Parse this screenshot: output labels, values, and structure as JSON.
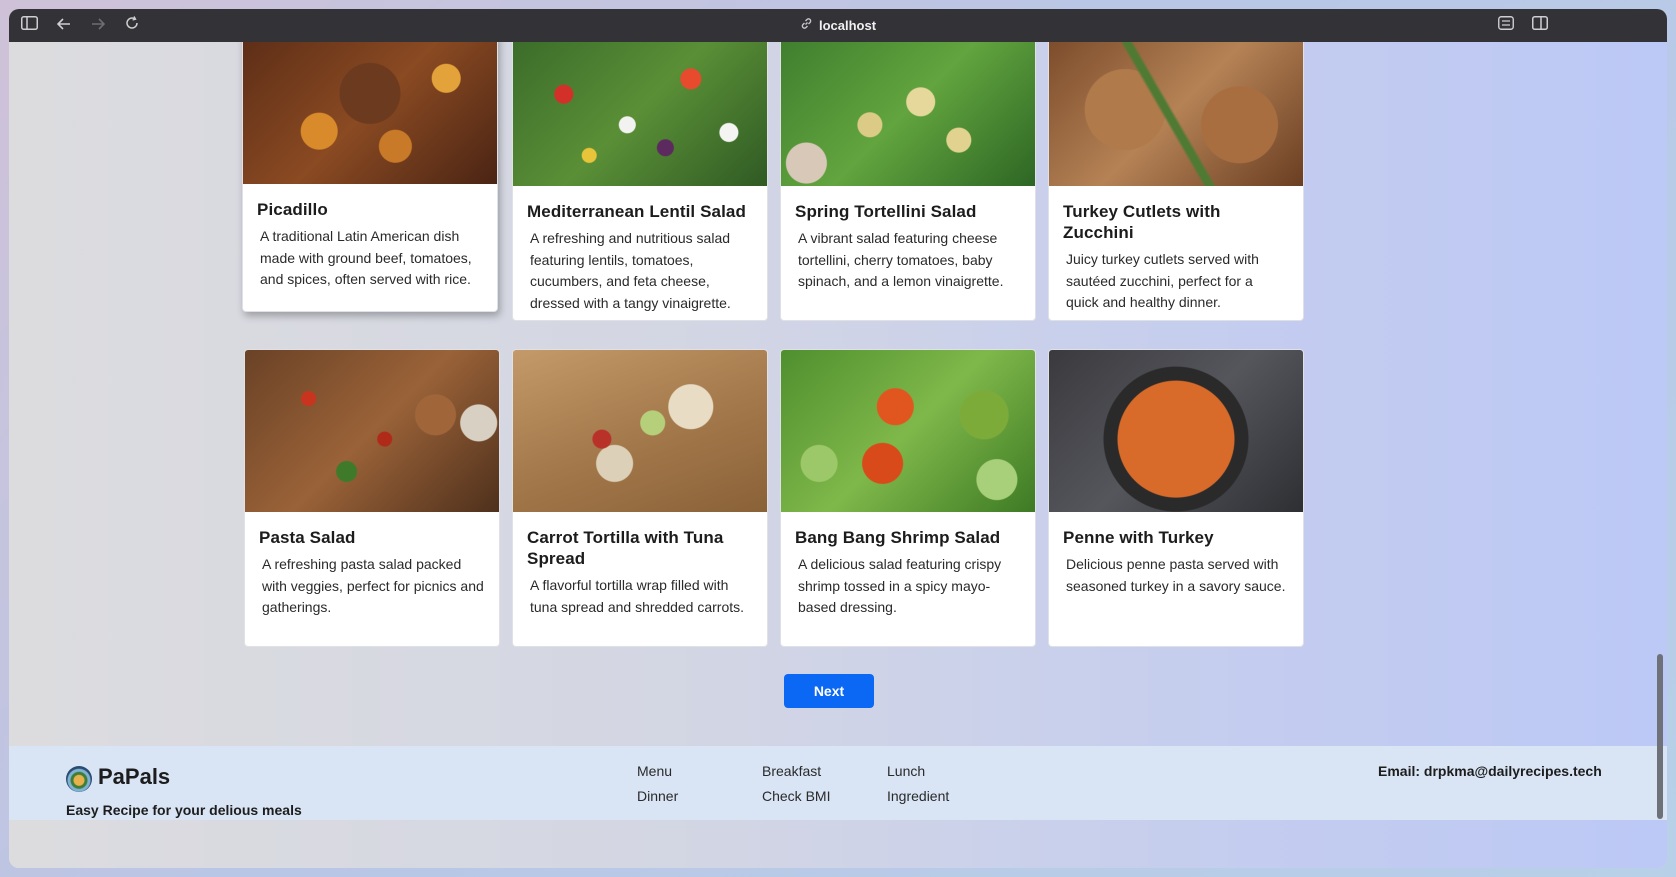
{
  "browser": {
    "url": "localhost",
    "sidebar_icon": "sidebar-icon",
    "back_icon": "arrow-left-icon",
    "forward_icon": "arrow-right-icon",
    "reload_icon": "reload-icon",
    "link_icon": "link-icon",
    "extensions_icon": "extensions-icon",
    "split_view_icon": "split-view-icon"
  },
  "recipes": [
    {
      "title": "Picadillo",
      "description": "A traditional Latin American dish made with ground beef, tomatoes, and spices, often served with rice.",
      "image_icon": "picadillo-photo"
    },
    {
      "title": "Mediterranean Lentil Salad",
      "description": "A refreshing and nutritious salad featuring lentils, tomatoes, cucumbers, and feta cheese, dressed with a tangy vinaigrette.",
      "image_icon": "lentil-salad-photo"
    },
    {
      "title": "Spring Tortellini Salad",
      "description": "A vibrant salad featuring cheese tortellini, cherry tomatoes, baby spinach, and a lemon vinaigrette.",
      "image_icon": "tortellini-salad-photo"
    },
    {
      "title": "Turkey Cutlets with Zucchini",
      "description": "Juicy turkey cutlets served with sautéed zucchini, perfect for a quick and healthy dinner.",
      "image_icon": "turkey-cutlets-photo"
    },
    {
      "title": "Pasta Salad",
      "description": "A refreshing pasta salad packed with veggies, perfect for picnics and gatherings.",
      "image_icon": "pasta-salad-photo"
    },
    {
      "title": "Carrot Tortilla with Tuna Spread",
      "description": "A flavorful tortilla wrap filled with tuna spread and shredded carrots.",
      "image_icon": "tortilla-wrap-photo"
    },
    {
      "title": "Bang Bang Shrimp Salad",
      "description": "A delicious salad featuring crispy shrimp tossed in a spicy mayo-based dressing.",
      "image_icon": "shrimp-salad-photo"
    },
    {
      "title": "Penne with Turkey",
      "description": "Delicious penne pasta served with seasoned turkey in a savory sauce.",
      "image_icon": "penne-turkey-photo"
    }
  ],
  "pagination": {
    "next_label": "Next"
  },
  "footer": {
    "brand": "PaPals",
    "tagline": "Easy Recipe for your delious meals",
    "links": [
      "Menu",
      "Breakfast",
      "Lunch",
      "Dinner",
      "Check BMI",
      "Ingredient"
    ],
    "email": "Email: drpkma@dailyrecipes.tech"
  },
  "colors": {
    "accent": "#0b68f4",
    "footer_bg": "#d9e5f5",
    "titlebar": "#333236"
  }
}
